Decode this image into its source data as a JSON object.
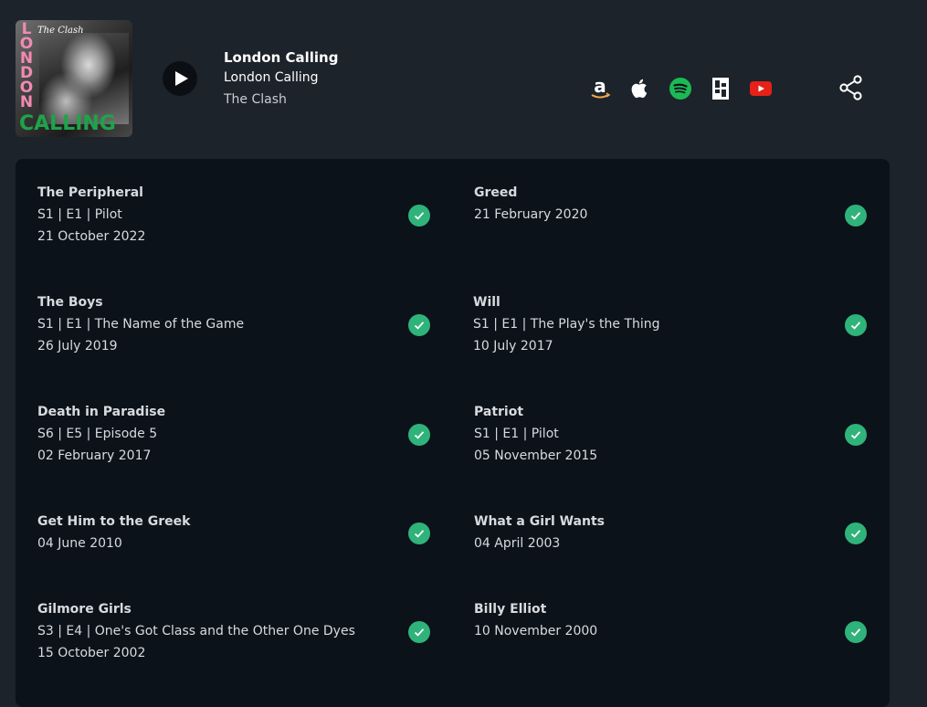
{
  "header": {
    "album_art": {
      "band_text": "The Clash",
      "title_top": "LONDON",
      "title_bottom": "CALLING"
    },
    "track_title": "London Calling",
    "album": "London Calling",
    "artist": "The Clash"
  },
  "services": [
    {
      "name": "amazon-music-icon"
    },
    {
      "name": "apple-music-icon"
    },
    {
      "name": "spotify-icon"
    },
    {
      "name": "deezer-icon"
    },
    {
      "name": "youtube-icon"
    }
  ],
  "colors": {
    "page_bg": "#1d232b",
    "panel_bg": "#0b1219",
    "check_green": "#2fb37a",
    "spotify_green": "#1db954",
    "youtube_red": "#e62117",
    "amazon_orange": "#f3a847"
  },
  "appearances": {
    "left": [
      {
        "title": "The Peripheral",
        "episode": "S1 | E1 | Pilot",
        "date": "21 October 2022"
      },
      {
        "title": "The Boys",
        "episode": "S1 | E1 | The Name of the Game",
        "date": "26 July 2019"
      },
      {
        "title": "Death in Paradise",
        "episode": "S6 | E5 | Episode 5",
        "date": "02 February 2017"
      },
      {
        "title": "Get Him to the Greek",
        "episode": "",
        "date": "04 June 2010"
      },
      {
        "title": "Gilmore Girls",
        "episode": "S3 | E4 | One's Got Class and the Other One Dyes",
        "date": "15 October 2002"
      }
    ],
    "right": [
      {
        "title": "Greed",
        "episode": "",
        "date": "21 February 2020"
      },
      {
        "title": "Will",
        "episode": "S1 | E1 | The Play's the Thing",
        "date": "10 July 2017"
      },
      {
        "title": "Patriot",
        "episode": "S1 | E1 | Pilot",
        "date": "05 November 2015"
      },
      {
        "title": "What a Girl Wants",
        "episode": "",
        "date": "04 April 2003"
      },
      {
        "title": "Billy Elliot",
        "episode": "",
        "date": "10 November 2000"
      }
    ]
  }
}
